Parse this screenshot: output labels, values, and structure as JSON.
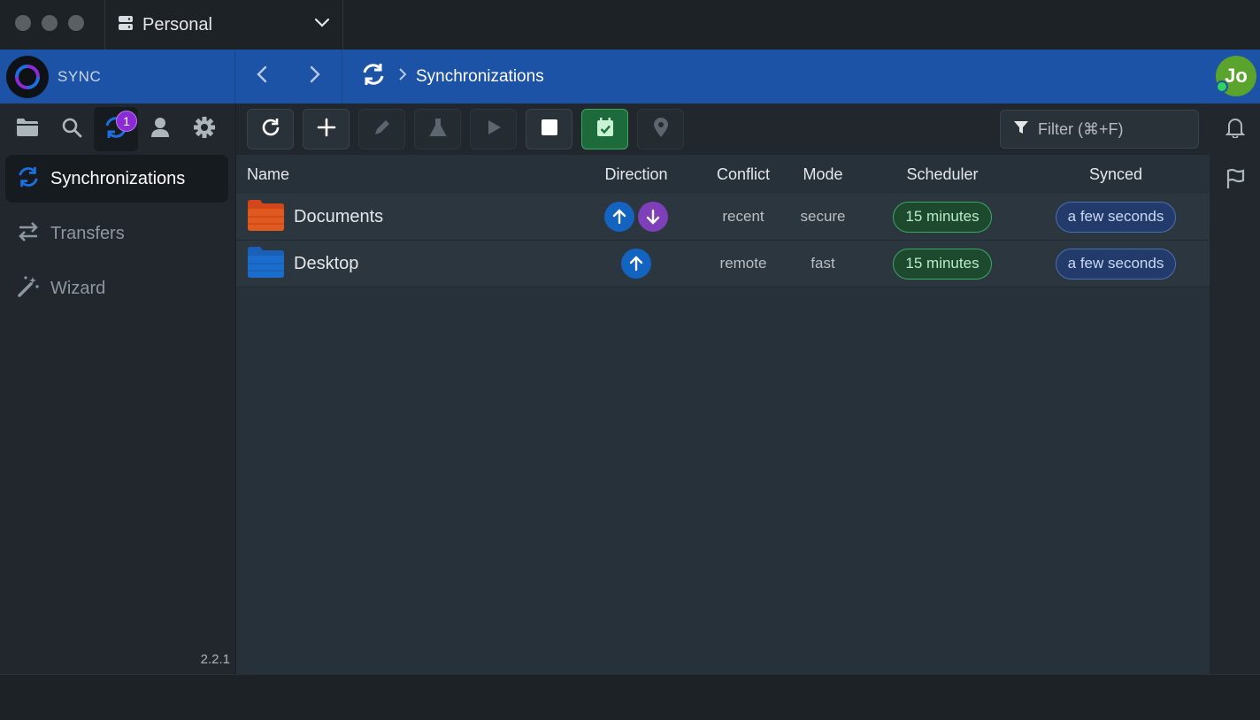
{
  "window": {
    "profile_label": "Personal"
  },
  "header": {
    "brand_name": "SYNC",
    "breadcrumb": "Synchronizations",
    "avatar_initials": "Jo"
  },
  "sidebar": {
    "badge_count": "1",
    "items": [
      {
        "label": "Synchronizations",
        "icon": "sync-icon",
        "active": true
      },
      {
        "label": "Transfers",
        "icon": "transfer-icon",
        "active": false
      },
      {
        "label": "Wizard",
        "icon": "magic-wand-icon",
        "active": false
      }
    ],
    "version": "2.2.1"
  },
  "toolbar": {
    "filter_placeholder": "Filter (⌘+F)"
  },
  "table": {
    "columns": [
      "Name",
      "Direction",
      "Conflict",
      "Mode",
      "Scheduler",
      "Synced"
    ],
    "rows": [
      {
        "name": "Documents",
        "folder_color": "#d2461a",
        "direction": [
          "up",
          "down"
        ],
        "conflict": "recent",
        "mode": "secure",
        "scheduler": "15 minutes",
        "synced": "a few seconds"
      },
      {
        "name": "Desktop",
        "folder_color": "#1a6ccd",
        "direction": [
          "up"
        ],
        "conflict": "remote",
        "mode": "fast",
        "scheduler": "15 minutes",
        "synced": "a few seconds"
      }
    ]
  },
  "colors": {
    "accent": "#1d53a6",
    "badge": "#8a2bd6",
    "scheduler_pill": "#3aa864",
    "synced_pill": "#4c6fb0"
  }
}
